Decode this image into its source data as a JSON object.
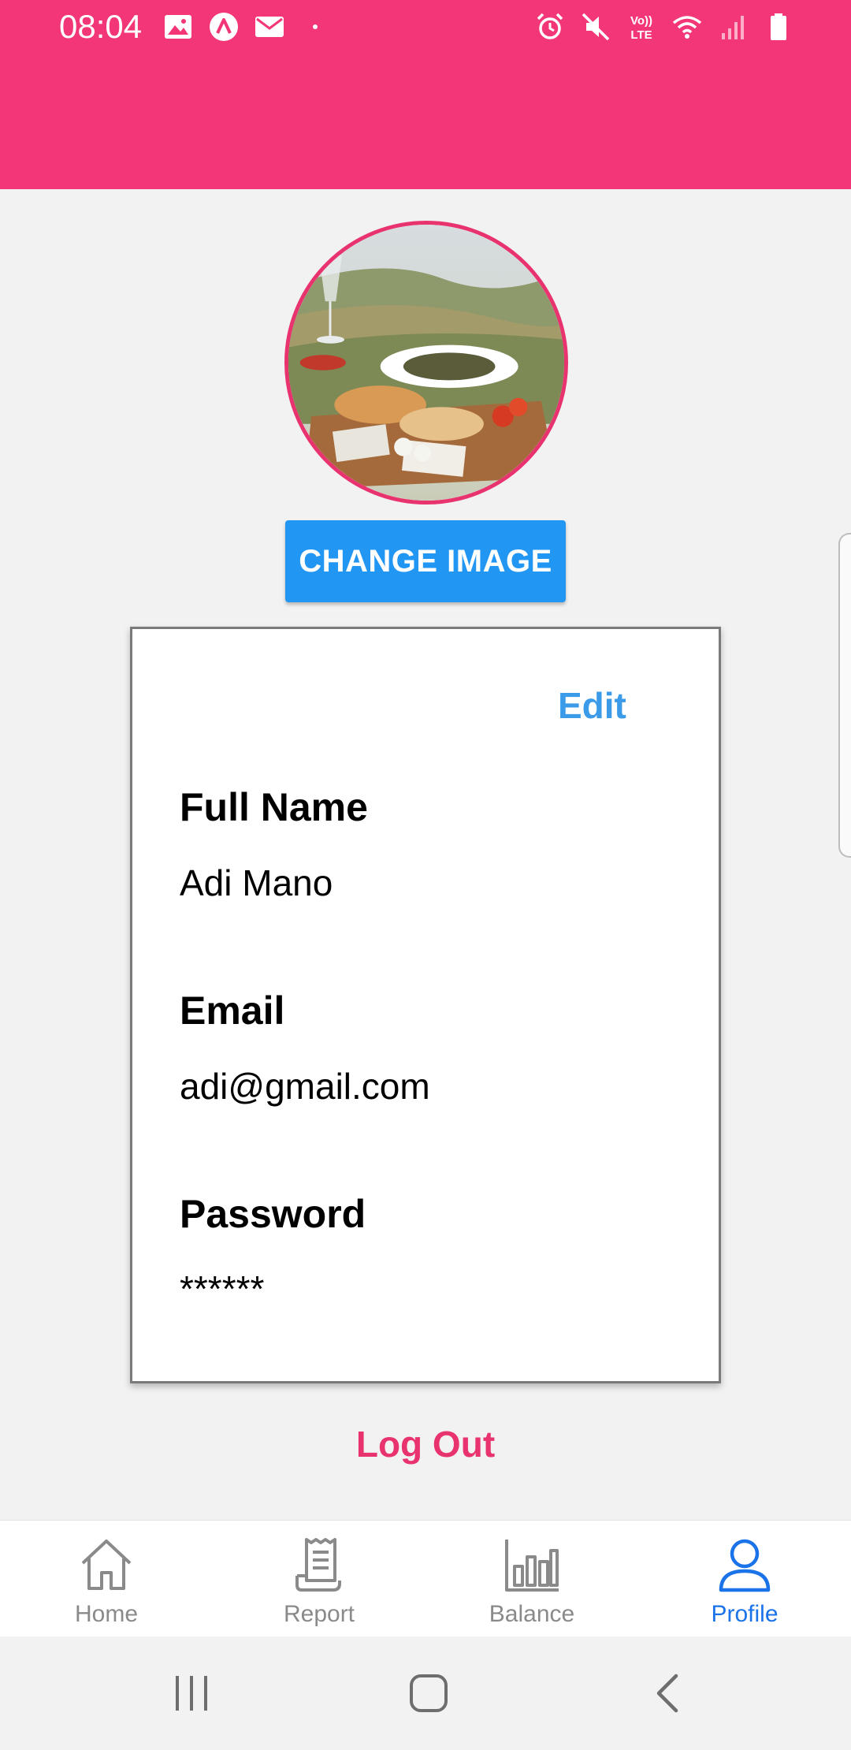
{
  "status_bar": {
    "time": "08:04",
    "left_icons": [
      "image-icon",
      "app-a-icon",
      "mail-icon",
      "dot-icon"
    ],
    "right_icons": [
      "alarm-icon",
      "mute-icon",
      "volte-icon",
      "wifi-icon",
      "signal-icon",
      "battery-icon"
    ],
    "volte_label": "Vo)) LTE"
  },
  "colors": {
    "header": "#f33677",
    "accent_pink": "#e8336f",
    "button_blue": "#2196f3",
    "edit_blue": "#3b9be9",
    "active_tab": "#1a73e8"
  },
  "profile": {
    "change_image_label": "CHANGE IMAGE",
    "edit_label": "Edit",
    "fields": [
      {
        "label": "Full Name",
        "value": "Adi Mano"
      },
      {
        "label": "Email",
        "value": "adi@gmail.com"
      },
      {
        "label": "Password",
        "value": "******"
      }
    ],
    "logout_label": "Log Out"
  },
  "bottom_nav": {
    "items": [
      {
        "label": "Home",
        "icon": "home-icon",
        "active": false
      },
      {
        "label": "Report",
        "icon": "receipt-icon",
        "active": false
      },
      {
        "label": "Balance",
        "icon": "bar-chart-icon",
        "active": false
      },
      {
        "label": "Profile",
        "icon": "user-icon",
        "active": true
      }
    ]
  },
  "system_nav": [
    "recents-icon",
    "home-button-icon",
    "back-icon"
  ]
}
